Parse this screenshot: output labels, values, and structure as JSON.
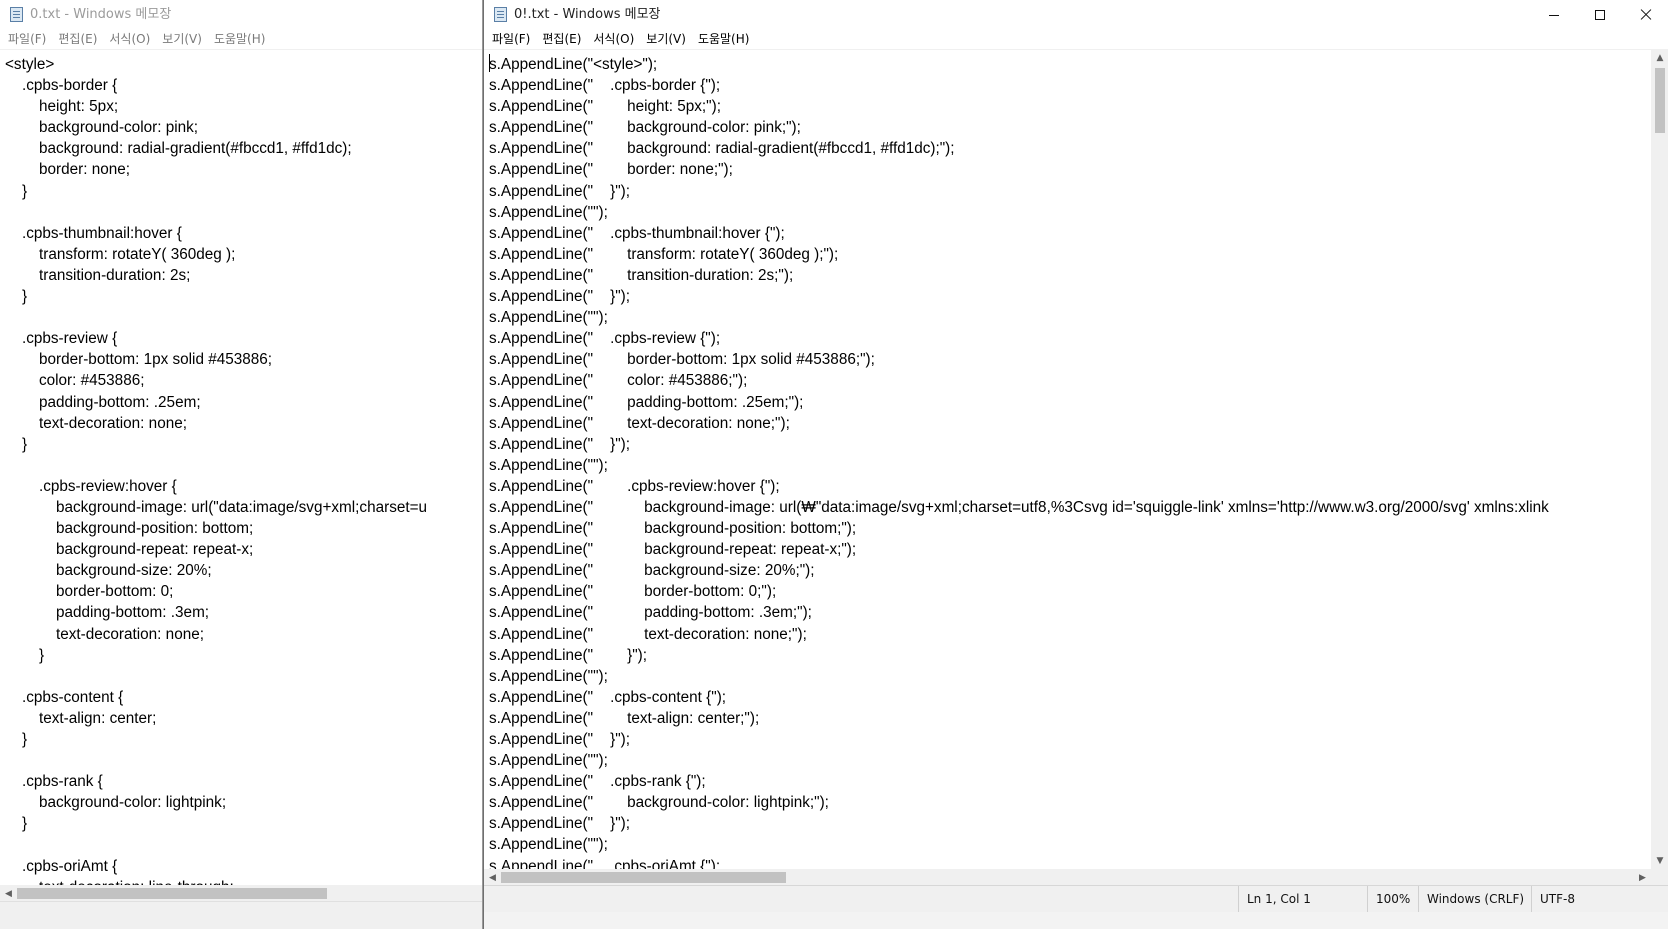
{
  "left_window": {
    "title": "0.txt - Windows 메모장",
    "menu": [
      {
        "label": "파일(F)"
      },
      {
        "label": "편집(E)"
      },
      {
        "label": "서식(O)"
      },
      {
        "label": "보기(V)"
      },
      {
        "label": "도움말(H)"
      }
    ],
    "text": "<style>\n    .cpbs-border {\n        height: 5px;\n        background-color: pink;\n        background: radial-gradient(#fbccd1, #ffd1dc);\n        border: none;\n    }\n\n    .cpbs-thumbnail:hover {\n        transform: rotateY( 360deg );\n        transition-duration: 2s;\n    }\n\n    .cpbs-review {\n        border-bottom: 1px solid #453886;\n        color: #453886;\n        padding-bottom: .25em;\n        text-decoration: none;\n    }\n\n        .cpbs-review:hover {\n            background-image: url(\"data:image/svg+xml;charset=u\n            background-position: bottom;\n            background-repeat: repeat-x;\n            background-size: 20%;\n            border-bottom: 0;\n            padding-bottom: .3em;\n            text-decoration: none;\n        }\n\n    .cpbs-content {\n        text-align: center;\n    }\n\n    .cpbs-rank {\n        background-color: lightpink;\n    }\n\n    .cpbs-oriAmt {\n        text-decoration: line-through;"
  },
  "right_window": {
    "title": "0!.txt - Windows 메모장",
    "menu": [
      {
        "label": "파일(F)"
      },
      {
        "label": "편집(E)"
      },
      {
        "label": "서식(O)"
      },
      {
        "label": "보기(V)"
      },
      {
        "label": "도움말(H)"
      }
    ],
    "text": "s.AppendLine(\"<style>\");\ns.AppendLine(\"    .cpbs-border {\");\ns.AppendLine(\"        height: 5px;\");\ns.AppendLine(\"        background-color: pink;\");\ns.AppendLine(\"        background: radial-gradient(#fbccd1, #ffd1dc);\");\ns.AppendLine(\"        border: none;\");\ns.AppendLine(\"    }\");\ns.AppendLine(\"\");\ns.AppendLine(\"    .cpbs-thumbnail:hover {\");\ns.AppendLine(\"        transform: rotateY( 360deg );\");\ns.AppendLine(\"        transition-duration: 2s;\");\ns.AppendLine(\"    }\");\ns.AppendLine(\"\");\ns.AppendLine(\"    .cpbs-review {\");\ns.AppendLine(\"        border-bottom: 1px solid #453886;\");\ns.AppendLine(\"        color: #453886;\");\ns.AppendLine(\"        padding-bottom: .25em;\");\ns.AppendLine(\"        text-decoration: none;\");\ns.AppendLine(\"    }\");\ns.AppendLine(\"\");\ns.AppendLine(\"        .cpbs-review:hover {\");\ns.AppendLine(\"            background-image: url(₩\"data:image/svg+xml;charset=utf8,%3Csvg id='squiggle-link' xmlns='http://www.w3.org/2000/svg' xmlns:xlink\ns.AppendLine(\"            background-position: bottom;\");\ns.AppendLine(\"            background-repeat: repeat-x;\");\ns.AppendLine(\"            background-size: 20%;\");\ns.AppendLine(\"            border-bottom: 0;\");\ns.AppendLine(\"            padding-bottom: .3em;\");\ns.AppendLine(\"            text-decoration: none;\");\ns.AppendLine(\"        }\");\ns.AppendLine(\"\");\ns.AppendLine(\"    .cpbs-content {\");\ns.AppendLine(\"        text-align: center;\");\ns.AppendLine(\"    }\");\ns.AppendLine(\"\");\ns.AppendLine(\"    .cpbs-rank {\");\ns.AppendLine(\"        background-color: lightpink;\");\ns.AppendLine(\"    }\");\ns.AppendLine(\"\");\ns.AppendLine(\"    .cpbs-oriAmt {\");\ns.AppendLine(\"        text-decoration: line-through;\");",
    "status": {
      "position": "Ln 1, Col 1",
      "zoom": "100%",
      "line_ending": "Windows (CRLF)",
      "encoding": "UTF-8"
    }
  },
  "icons": {
    "app": "notepad-icon",
    "minimize": "minimize-icon",
    "maximize": "maximize-icon",
    "close": "close-icon"
  }
}
